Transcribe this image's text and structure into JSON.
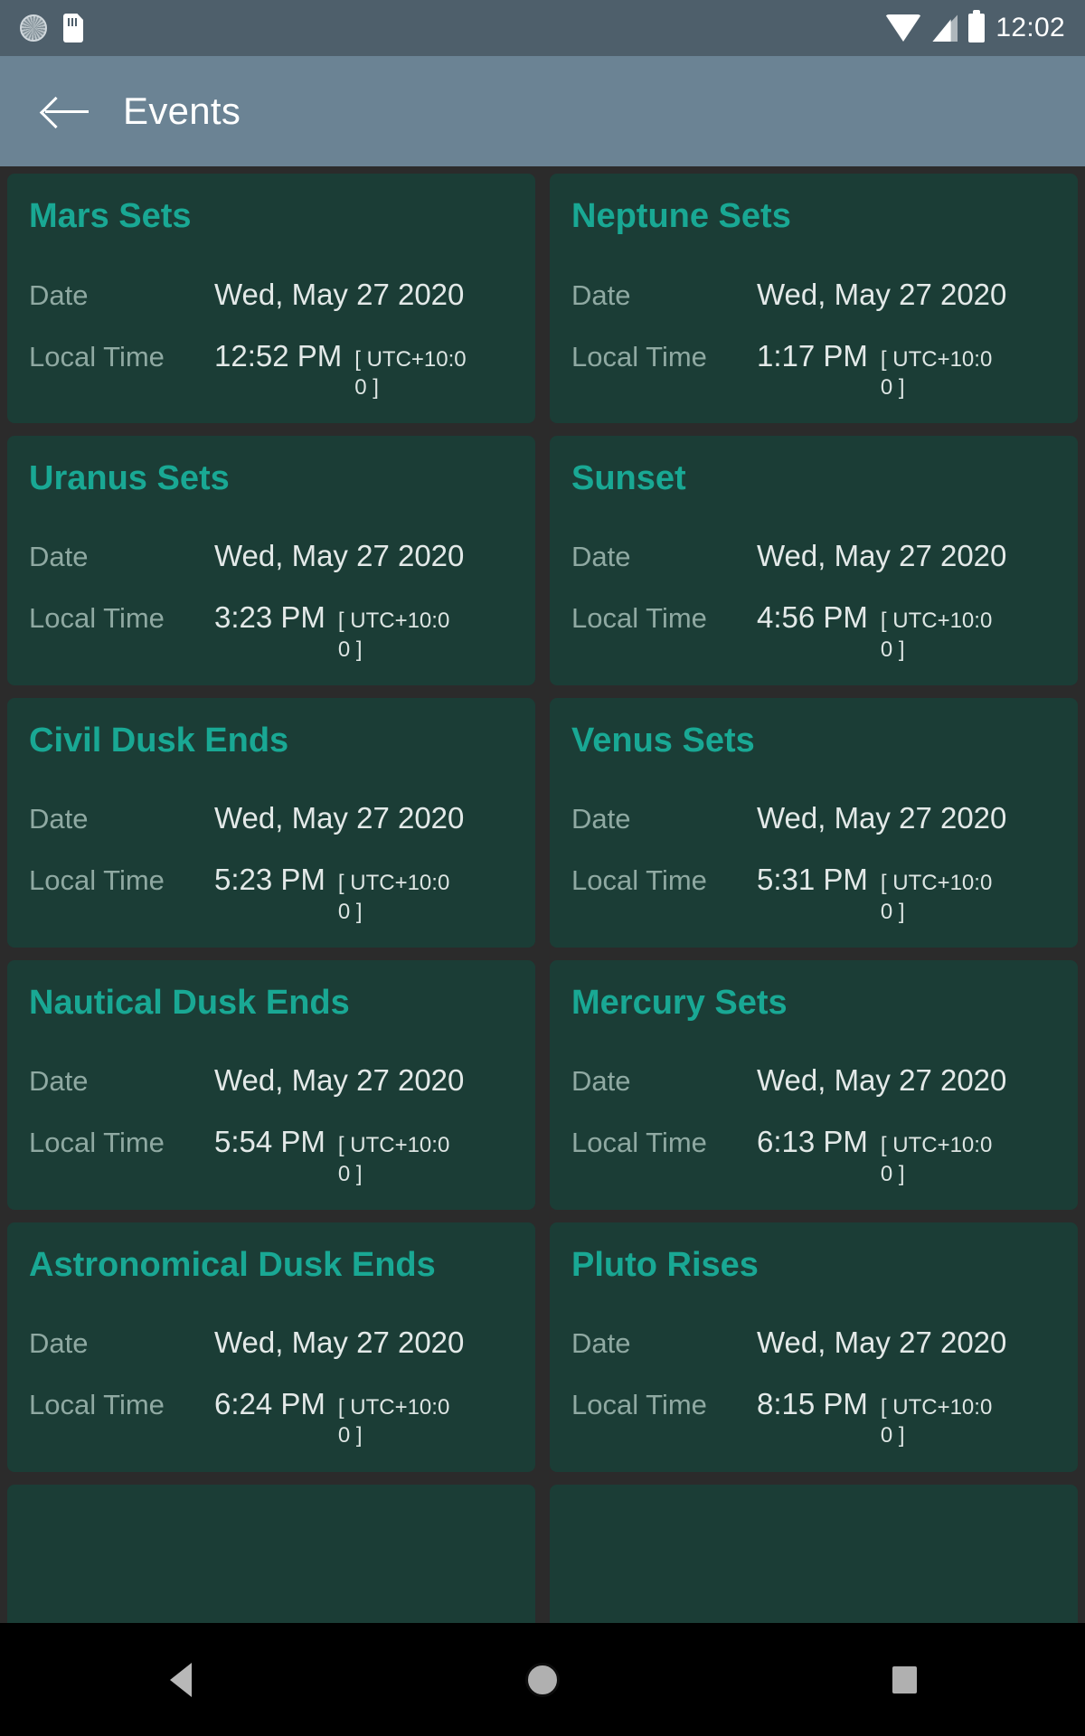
{
  "status_bar": {
    "time": "12:02",
    "icons": [
      "screenshot-icon",
      "sdcard-icon",
      "wifi-icon",
      "signal-icon",
      "battery-icon"
    ]
  },
  "app_bar": {
    "back_label": "back-arrow",
    "title": "Events"
  },
  "labels": {
    "date": "Date",
    "local_time": "Local Time"
  },
  "colors": {
    "status_bar": "#4e5f6b",
    "app_bar": "#6b8394",
    "page_background": "#2b2b2b",
    "card_background": "#1b3d36",
    "card_title": "#19a894",
    "label_text": "#8fa9a2",
    "value_text": "#e3e9e8"
  },
  "events": [
    {
      "title": "Mars Sets",
      "date": "Wed, May 27  2020",
      "time": "12:52 PM",
      "utc": "[ UTC+10:00 ]"
    },
    {
      "title": "Neptune Sets",
      "date": "Wed, May 27  2020",
      "time": "1:17 PM",
      "utc": "[ UTC+10:00 ]"
    },
    {
      "title": "Uranus Sets",
      "date": "Wed, May 27  2020",
      "time": "3:23 PM",
      "utc": "[ UTC+10:00 ]"
    },
    {
      "title": "Sunset",
      "date": "Wed, May 27  2020",
      "time": "4:56 PM",
      "utc": "[ UTC+10:00 ]"
    },
    {
      "title": "Civil Dusk Ends",
      "date": "Wed, May 27  2020",
      "time": "5:23 PM",
      "utc": "[ UTC+10:00 ]"
    },
    {
      "title": "Venus Sets",
      "date": "Wed, May 27  2020",
      "time": "5:31 PM",
      "utc": "[ UTC+10:00 ]"
    },
    {
      "title": "Nautical Dusk Ends",
      "date": "Wed, May 27  2020",
      "time": "5:54 PM",
      "utc": "[ UTC+10:00 ]"
    },
    {
      "title": "Mercury Sets",
      "date": "Wed, May 27  2020",
      "time": "6:13 PM",
      "utc": "[ UTC+10:00 ]"
    },
    {
      "title": "Astronomical Dusk Ends",
      "date": "Wed, May 27  2020",
      "time": "6:24 PM",
      "utc": "[ UTC+10:00 ]"
    },
    {
      "title": "Pluto Rises",
      "date": "Wed, May 27  2020",
      "time": "8:15 PM",
      "utc": "[ UTC+10:00 ]"
    },
    {
      "title": "",
      "date": "",
      "time": "",
      "utc": ""
    },
    {
      "title": "",
      "date": "",
      "time": "",
      "utc": ""
    }
  ],
  "nav_bar": {
    "back": "nav-back-icon",
    "home": "nav-home-icon",
    "recent": "nav-recent-icon"
  }
}
